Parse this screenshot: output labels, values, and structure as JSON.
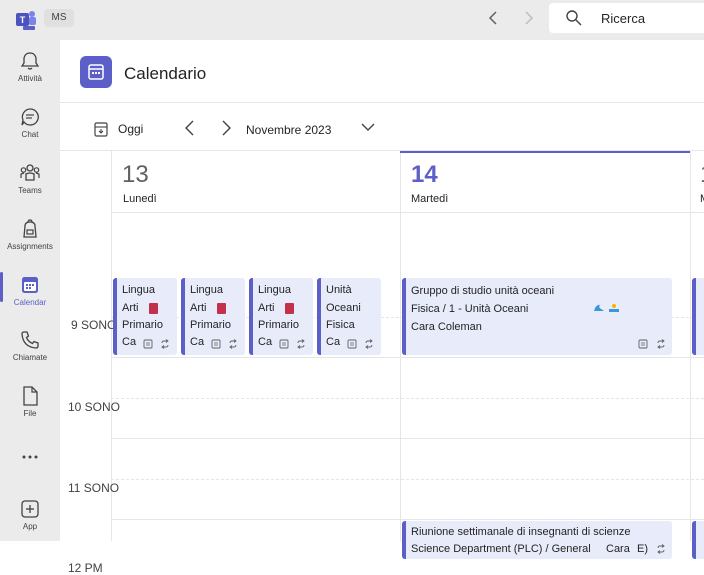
{
  "topbar": {
    "account_chip": "MS",
    "search_placeholder": "Ricerca"
  },
  "rail": {
    "items": [
      {
        "label": "Attività"
      },
      {
        "label": "Chat"
      },
      {
        "label": "Teams"
      },
      {
        "label": "Assignments"
      },
      {
        "label": "Calendar"
      },
      {
        "label": "Chiamate"
      },
      {
        "label": "File"
      },
      {
        "label": "App"
      }
    ]
  },
  "header": {
    "title": "Calendario"
  },
  "toolbar": {
    "today_label": "Oggi",
    "month_label": "Novembre 2023"
  },
  "days": [
    {
      "number": "13",
      "name": "Lunedì"
    },
    {
      "number": "14",
      "name": "Martedì"
    }
  ],
  "time_labels": [
    "9 SONO",
    "10 SONO",
    "11 SONO",
    "12 PM"
  ],
  "events": {
    "mon_1": {
      "l1": "Lingua",
      "l2": "Arti",
      "l3": "Primario",
      "l4": "Ca"
    },
    "mon_2": {
      "l1": "Lingua",
      "l2": "Arti",
      "l3": "Primario",
      "l4": "Ca"
    },
    "mon_3": {
      "l1": "Lingua",
      "l2": "Arti",
      "l3": "Primario",
      "l4": "Ca"
    },
    "mon_4": {
      "l1": "Unità",
      "l2": "Oceani",
      "l3": "Fisica",
      "l4": "Ca"
    },
    "tue_1": {
      "title": "Gruppo di studio unità oceani",
      "subtitle": "Fisica / 1 - Unità Oceani",
      "organizer": "Cara Coleman"
    },
    "tue_2": {
      "title": "Riunione settimanale di insegnanti di scienze",
      "subtitle": "Science Department (PLC) / General",
      "organizer": "Cara",
      "extra": "E)"
    }
  },
  "colors": {
    "accent": "#5b5fc7",
    "event_bg": "#e8ebfa",
    "rail_bg": "#ebebeb"
  }
}
